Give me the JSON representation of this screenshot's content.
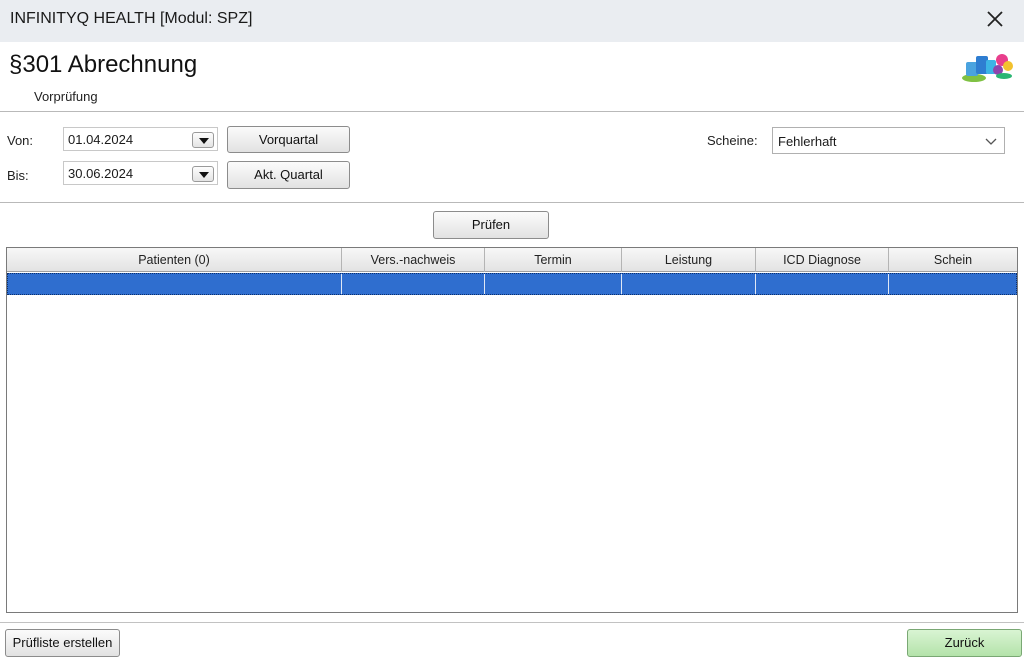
{
  "window": {
    "title": "INFINITYQ HEALTH [Modul: SPZ]",
    "close_icon": "close-icon"
  },
  "header": {
    "title": "§301 Abrechnung",
    "subtitle": "Vorprüfung",
    "logo_icon": "app-logo-icon"
  },
  "filters": {
    "von_label": "Von:",
    "von_value": "01.04.2024",
    "bis_label": "Bis:",
    "bis_value": "30.06.2024",
    "vorquartal_label": "Vorquartal",
    "akt_quartal_label": "Akt. Quartal",
    "scheine_label": "Scheine:",
    "scheine_value": "Fehlerhaft"
  },
  "actions": {
    "pruefen_label": "Prüfen"
  },
  "table": {
    "columns": [
      "Patienten (0)",
      "Vers.-nachweis",
      "Termin",
      "Leistung",
      "ICD Diagnose",
      "Schein"
    ],
    "rows": [
      [
        "",
        "",
        "",
        "",
        "",
        ""
      ]
    ]
  },
  "footer": {
    "pruefliste_label": "Prüfliste erstellen",
    "zurueck_label": "Zurück"
  },
  "colors": {
    "selection": "#2f6ecf",
    "zurueck_bg": "#c9ecc2",
    "titlebar_bg": "#eaedf1"
  }
}
